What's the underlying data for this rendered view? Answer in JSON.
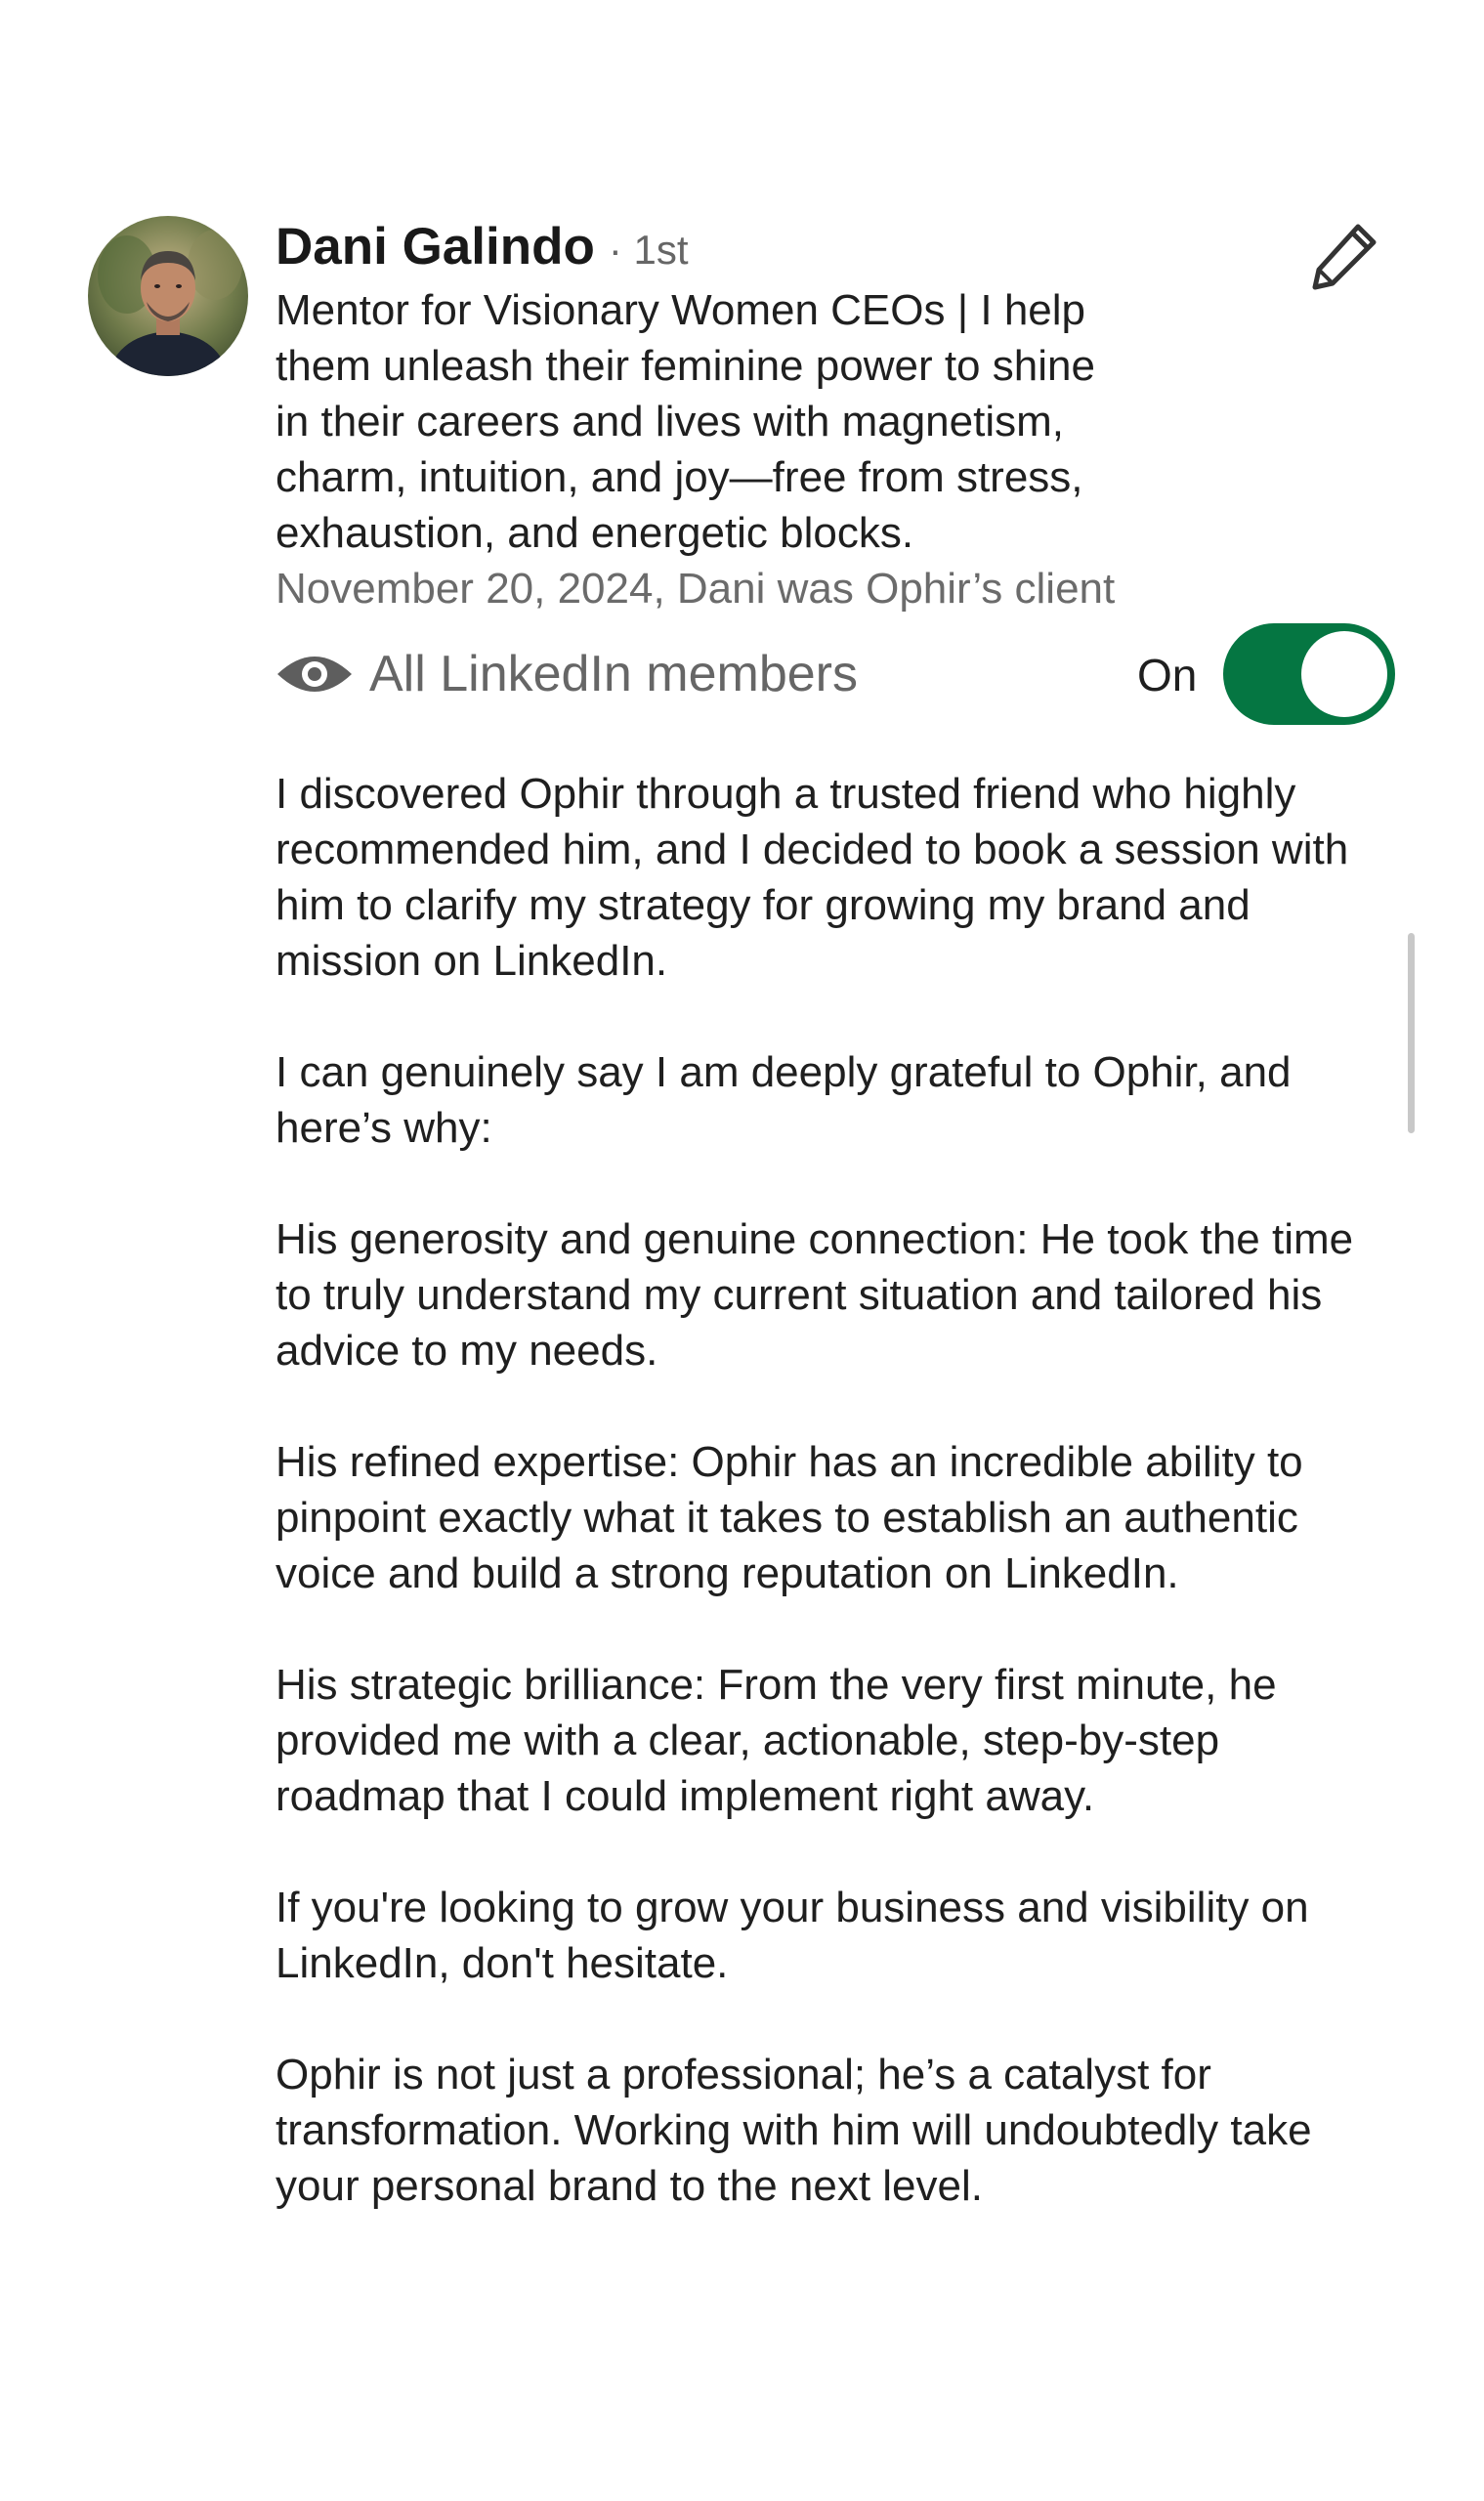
{
  "recommender": {
    "name": "Dani Galindo",
    "degree": "· 1st",
    "headline_lines": [
      "Mentor for Visionary Women CEOs | I help",
      "them unleash their feminine power to shine",
      "in their careers and lives with magnetism,",
      "charm, intuition, and joy—free from stress,",
      "exhaustion, and energetic blocks."
    ],
    "relationship": "November 20, 2024, Dani was Ophir’s client",
    "avatar_icon": "profile-photo"
  },
  "edit": {
    "icon": "pencil-icon"
  },
  "visibility": {
    "icon": "eye-icon",
    "label": "All LinkedIn members",
    "state_label": "On",
    "toggle_on": true,
    "toggle_color": "#057642"
  },
  "recommendation": {
    "paragraphs": [
      "I discovered Ophir through a trusted friend who highly recommended him, and I decided to book a session with him to clarify my strategy for growing my brand and mission on LinkedIn.",
      "I can genuinely say I am deeply grateful to Ophir, and here’s why:",
      "His generosity and genuine connection: He took the time to truly understand my current situation and tailored his advice to my needs.",
      "His refined expertise: Ophir has an incredible ability to pinpoint exactly what it takes to establish an authentic voice and build a strong reputation on LinkedIn.",
      "His strategic brilliance: From the very first minute, he provided me with a clear, actionable, step-by-step roadmap that I could implement right away.",
      "If you're looking to grow your business and visibility on LinkedIn, don't hesitate.",
      "Ophir is not just a professional; he’s a catalyst for transformation. Working with him will undoubtedly take your personal brand to the next level."
    ]
  }
}
